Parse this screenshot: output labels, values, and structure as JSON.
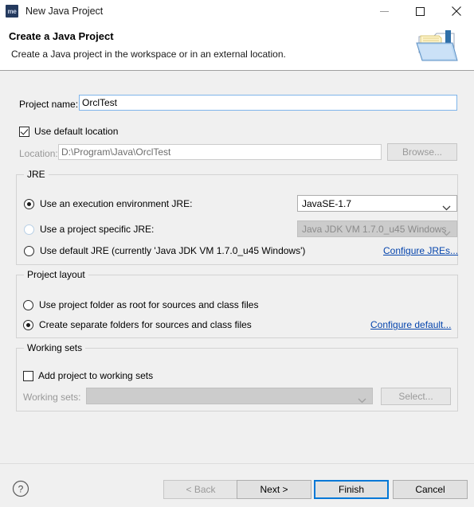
{
  "window": {
    "title": "New Java Project",
    "app_icon_text": "me",
    "controls": {
      "minimize": "minimize-button",
      "maximize": "maximize-button",
      "close": "close-button"
    }
  },
  "header": {
    "title": "Create a Java Project",
    "subtitle": "Create a Java project in the workspace or in an external location.",
    "icon": "java-project-folder-icon"
  },
  "form": {
    "project_name": {
      "label": "Project name:",
      "value": "OrclTest",
      "placeholder": ""
    },
    "use_default_location": {
      "label": "Use default location",
      "checked": true
    },
    "location": {
      "label": "Location:",
      "value": "D:\\Program\\Java\\OrclTest",
      "enabled": false
    },
    "browse_button": {
      "label": "Browse...",
      "enabled": false
    }
  },
  "jre": {
    "group_title": "JRE",
    "options": [
      {
        "label": "Use an execution environment JRE:",
        "selected": true,
        "enabled": true
      },
      {
        "label": "Use a project specific JRE:",
        "selected": false,
        "enabled": false
      },
      {
        "label": "Use default JRE (currently 'Java JDK VM 1.7.0_u45 Windows')",
        "selected": false,
        "enabled": true
      }
    ],
    "execution_environment_select": {
      "value": "JavaSE-1.7",
      "enabled": true
    },
    "project_jre_select": {
      "value": "Java JDK VM 1.7.0_u45 Windows",
      "enabled": false
    },
    "configure_link": "Configure JREs..."
  },
  "project_layout": {
    "group_title": "Project layout",
    "options": [
      {
        "label": "Use project folder as root for sources and class files",
        "selected": false
      },
      {
        "label": "Create separate folders for sources and class files",
        "selected": true
      }
    ],
    "configure_link": "Configure default..."
  },
  "working_sets": {
    "group_title": "Working sets",
    "add_checkbox": {
      "label": "Add project to working sets",
      "checked": false
    },
    "select_label": "Working sets:",
    "select_value": "",
    "select_button": "Select..."
  },
  "footer": {
    "help_icon": "help-question-icon",
    "buttons": [
      {
        "label": "< Back",
        "enabled": false,
        "default": false
      },
      {
        "label": "Next >",
        "enabled": true,
        "default": false
      },
      {
        "label": "Finish",
        "enabled": true,
        "default": true
      },
      {
        "label": "Cancel",
        "enabled": true,
        "default": false
      }
    ]
  },
  "colors": {
    "dialog_background": "#f0f0f0",
    "header_background": "#ffffff",
    "focus_blue": "#0078d7",
    "link_blue": "#0645ad",
    "input_border_focus": "#7eb4ea",
    "disabled_text": "#989898"
  }
}
